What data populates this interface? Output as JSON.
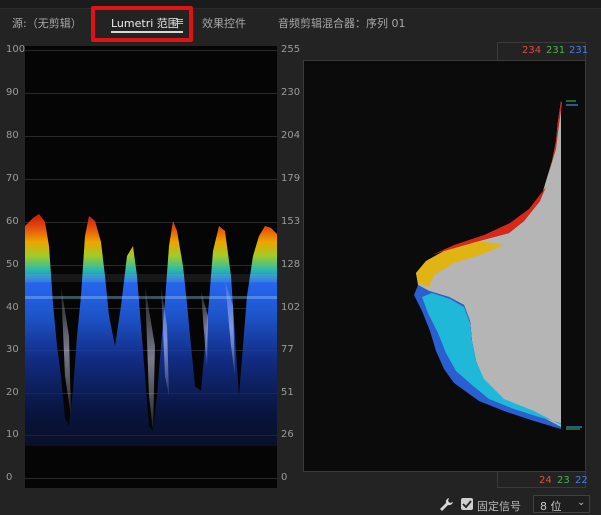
{
  "tabs": {
    "source": "源:（无剪辑）",
    "lumetri": "Lumetri 范围",
    "lumetri_menu": "≡",
    "effects": "效果控件",
    "mixer": "音频剪辑混合器：序列 01"
  },
  "waveform": {
    "left_ticks": [
      "100",
      "90",
      "80",
      "70",
      "60",
      "50",
      "40",
      "30",
      "20",
      "10",
      "0"
    ],
    "right_ticks": [
      "255",
      "230",
      "204",
      "179",
      "153",
      "128",
      "102",
      "77",
      "51",
      "26",
      "0"
    ]
  },
  "histogram": {
    "top_values": [
      {
        "text": "234",
        "color": "#e04b3f"
      },
      {
        "text": "231",
        "color": "#4caf50"
      },
      {
        "text": "231",
        "color": "#4f7bd9"
      }
    ],
    "bottom_values": [
      {
        "text": "24",
        "color": "#e04b3f"
      },
      {
        "text": "23",
        "color": "#4caf50"
      },
      {
        "text": "22",
        "color": "#4f7bd9"
      }
    ]
  },
  "footer": {
    "pin_label": "固定信号",
    "pin_checked": true,
    "bit_depth": "8 位",
    "bit_arrow": "⌄"
  }
}
